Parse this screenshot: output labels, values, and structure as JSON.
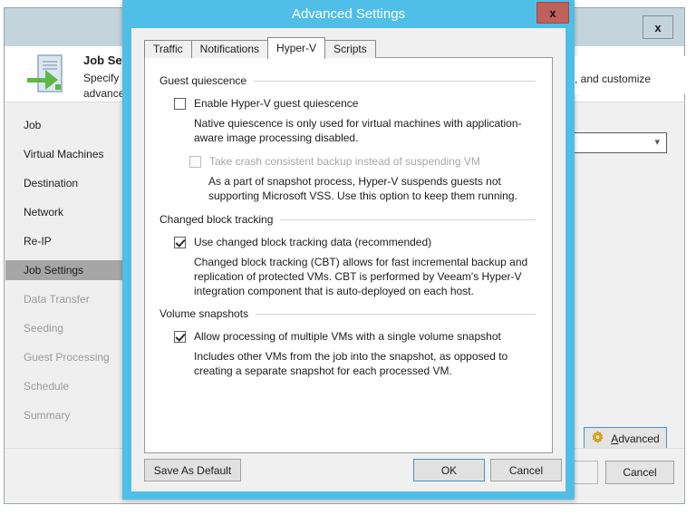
{
  "background_window": {
    "close_label": "x",
    "header": {
      "title": "Job Settin",
      "line1": "Specify ba",
      "line2": "advanced ",
      "right_fragment": ", and customize",
      "icon": "document-arrow-icon"
    },
    "sidebar": {
      "items": [
        {
          "label": "Job",
          "state": "normal"
        },
        {
          "label": "Virtual Machines",
          "state": "normal"
        },
        {
          "label": "Destination",
          "state": "normal"
        },
        {
          "label": "Network",
          "state": "normal"
        },
        {
          "label": "Re-IP",
          "state": "normal"
        },
        {
          "label": "Job Settings",
          "state": "selected"
        },
        {
          "label": "Data Transfer",
          "state": "disabled"
        },
        {
          "label": "Seeding",
          "state": "disabled"
        },
        {
          "label": "Guest Processing",
          "state": "disabled"
        },
        {
          "label": "Schedule",
          "state": "disabled"
        },
        {
          "label": "Summary",
          "state": "disabled"
        }
      ]
    },
    "combobox": {
      "value": "",
      "icon": "chevron-down-icon"
    },
    "advanced_button": {
      "label_before": "",
      "accel": "A",
      "label_after": "dvanced",
      "icon": "gear-icon"
    },
    "footer": {
      "partial_label": "",
      "cancel_label": "Cancel"
    }
  },
  "modal": {
    "title": "Advanced Settings",
    "close_label": "x",
    "tabs": [
      {
        "label": "Traffic",
        "active": false
      },
      {
        "label": "Notifications",
        "active": false
      },
      {
        "label": "Hyper-V",
        "active": true
      },
      {
        "label": "Scripts",
        "active": false
      }
    ],
    "groups": {
      "guest_quiescence": {
        "title": "Guest quiescence",
        "enable_checkbox": {
          "label": "Enable Hyper-V guest quiescence",
          "checked": false,
          "disabled": false
        },
        "description": "Native quiescence is only used for virtual machines with application-aware image processing disabled.",
        "crash_checkbox": {
          "label": "Take crash consistent backup instead of suspending VM",
          "checked": false,
          "disabled": true
        },
        "crash_description": "As a part of snapshot process, Hyper-V suspends guests not supporting Microsoft VSS. Use this option to keep them running."
      },
      "changed_block_tracking": {
        "title": "Changed block tracking",
        "checkbox": {
          "label": "Use changed block tracking data (recommended)",
          "checked": true,
          "disabled": false
        },
        "description": "Changed block tracking (CBT) allows for fast incremental backup and replication of protected VMs. CBT is performed by Veeam's Hyper-V integration component that is auto-deployed on each host."
      },
      "volume_snapshots": {
        "title": "Volume snapshots",
        "checkbox": {
          "label": "Allow processing of multiple VMs with a single volume snapshot",
          "checked": true,
          "disabled": false
        },
        "description": "Includes other VMs from the job into the snapshot, as opposed to creating a separate snapshot for each processed VM."
      }
    },
    "buttons": {
      "save_as_default": "Save As Default",
      "ok": "OK",
      "cancel": "Cancel"
    }
  },
  "colors": {
    "modal_accent": "#4fbfe8",
    "modal_close": "#c0605a",
    "selection": "#a6a6a6",
    "focus_border": "#3f93cd",
    "gear": "#e8a317"
  }
}
